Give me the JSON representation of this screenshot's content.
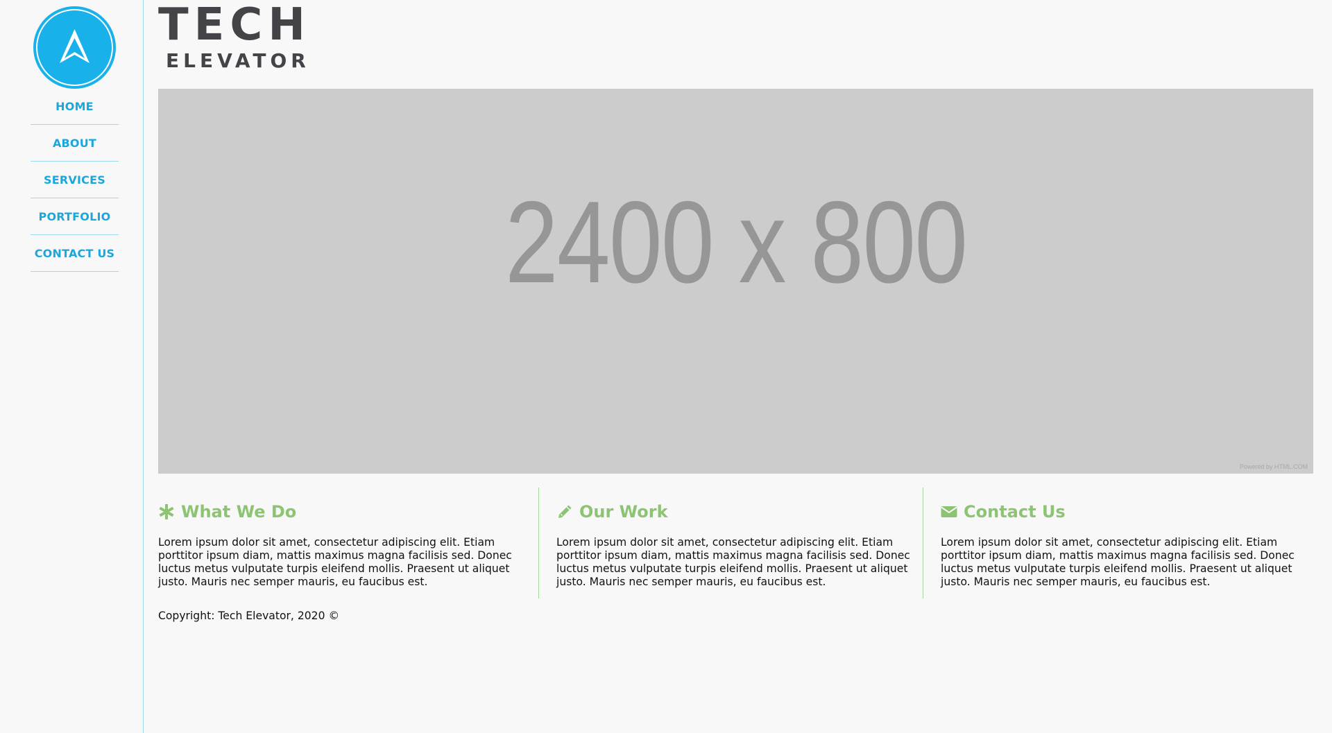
{
  "sidebar": {
    "logo_icon": "tech-elevator-arrow-icon",
    "nav": [
      {
        "label": "HOME"
      },
      {
        "label": "ABOUT"
      },
      {
        "label": "SERVICES"
      },
      {
        "label": "PORTFOLIO"
      },
      {
        "label": "CONTACT US"
      }
    ]
  },
  "header": {
    "brand_line1": "TECH",
    "brand_line2": "ELEVATOR"
  },
  "hero": {
    "placeholder_text": "2400 x 800",
    "credit": "Powered by HTML.COM"
  },
  "sections": [
    {
      "icon": "asterisk-icon",
      "title": "What We Do",
      "body": "Lorem ipsum dolor sit amet, consectetur adipiscing elit. Etiam porttitor ipsum diam, mattis maximus magna facilisis sed. Donec luctus metus vulputate turpis eleifend mollis. Praesent ut aliquet justo. Mauris nec semper mauris, eu faucibus est."
    },
    {
      "icon": "pencil-icon",
      "title": "Our Work",
      "body": "Lorem ipsum dolor sit amet, consectetur adipiscing elit. Etiam porttitor ipsum diam, mattis maximus magna facilisis sed. Donec luctus metus vulputate turpis eleifend mollis. Praesent ut aliquet justo. Mauris nec semper mauris, eu faucibus est."
    },
    {
      "icon": "envelope-icon",
      "title": "Contact Us",
      "body": "Lorem ipsum dolor sit amet, consectetur adipiscing elit. Etiam porttitor ipsum diam, mattis maximus magna facilisis sed. Donec luctus metus vulputate turpis eleifend mollis. Praesent ut aliquet justo. Mauris nec semper mauris, eu faucibus est."
    }
  ],
  "footer": {
    "copyright": "Copyright: Tech Elevator, 2020 ©"
  },
  "colors": {
    "accent_blue": "#19b1ea",
    "accent_green": "#8cc474",
    "brand_gray": "#444448",
    "placeholder_bg": "#cccccc"
  }
}
